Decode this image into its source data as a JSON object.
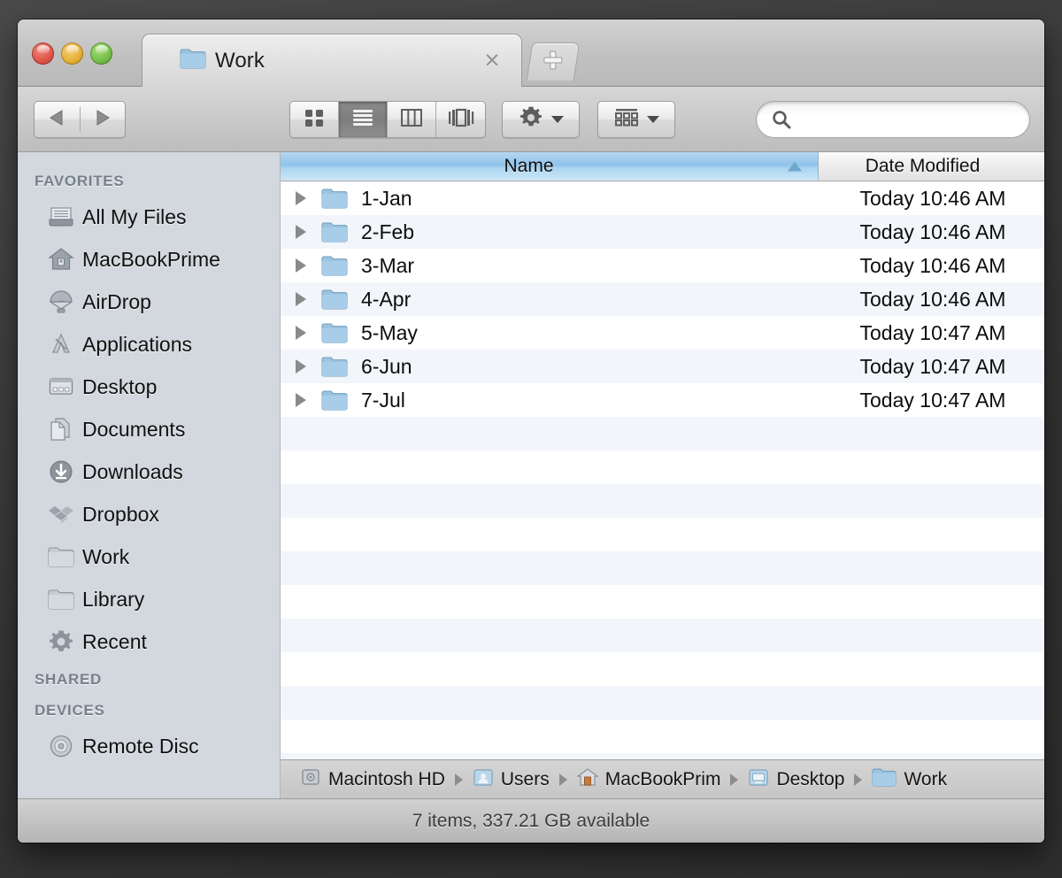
{
  "window": {
    "title": "Work",
    "traffic_lights": [
      {
        "name": "close",
        "color": "#e0574a"
      },
      {
        "name": "minimize",
        "color": "#e7b239"
      },
      {
        "name": "zoom",
        "color": "#77c04a"
      }
    ]
  },
  "tabs": {
    "active_tab_label": "Work",
    "close_glyph": "×",
    "new_tab_label": "+"
  },
  "toolbar": {
    "back_icon": "back-arrow-icon",
    "forward_icon": "forward-arrow-icon",
    "view_modes": [
      {
        "name": "icon-view",
        "selected": false
      },
      {
        "name": "list-view",
        "selected": true
      },
      {
        "name": "column-view",
        "selected": false
      },
      {
        "name": "coverflow-view",
        "selected": false
      }
    ],
    "action_menu_icon": "gear-icon",
    "arrange_menu_icon": "arrange-grid-icon",
    "search": {
      "value": "",
      "placeholder": "",
      "icon": "search-icon"
    }
  },
  "sidebar": {
    "sections": [
      {
        "header": "FAVORITES",
        "items": [
          {
            "label": "All My Files",
            "icon": "all-my-files-icon"
          },
          {
            "label": "MacBookPrime",
            "icon": "home-icon"
          },
          {
            "label": "AirDrop",
            "icon": "airdrop-parachute-icon"
          },
          {
            "label": "Applications",
            "icon": "applications-icon"
          },
          {
            "label": "Desktop",
            "icon": "desktop-icon"
          },
          {
            "label": "Documents",
            "icon": "documents-icon"
          },
          {
            "label": "Downloads",
            "icon": "downloads-icon"
          },
          {
            "label": "Dropbox",
            "icon": "dropbox-icon"
          },
          {
            "label": "Work",
            "icon": "folder-icon"
          },
          {
            "label": "Library",
            "icon": "folder-icon"
          },
          {
            "label": "Recent",
            "icon": "gear-icon"
          }
        ]
      },
      {
        "header": "SHARED",
        "items": []
      },
      {
        "header": "DEVICES",
        "items": [
          {
            "label": "Remote Disc",
            "icon": "optical-disc-icon"
          }
        ]
      }
    ]
  },
  "file_list": {
    "columns": [
      {
        "key": "name",
        "label": "Name",
        "sorted": true,
        "sort_direction": "ascending"
      },
      {
        "key": "date_modified",
        "label": "Date Modified",
        "sorted": false
      }
    ],
    "rows": [
      {
        "name": "1-Jan",
        "date_modified": "Today 10:46 AM",
        "icon": "folder-icon",
        "expandable": true
      },
      {
        "name": "2-Feb",
        "date_modified": "Today 10:46 AM",
        "icon": "folder-icon",
        "expandable": true
      },
      {
        "name": "3-Mar",
        "date_modified": "Today 10:46 AM",
        "icon": "folder-icon",
        "expandable": true
      },
      {
        "name": "4-Apr",
        "date_modified": "Today 10:46 AM",
        "icon": "folder-icon",
        "expandable": true
      },
      {
        "name": "5-May",
        "date_modified": "Today 10:47 AM",
        "icon": "folder-icon",
        "expandable": true
      },
      {
        "name": "6-Jun",
        "date_modified": "Today 10:47 AM",
        "icon": "folder-icon",
        "expandable": true
      },
      {
        "name": "7-Jul",
        "date_modified": "Today 10:47 AM",
        "icon": "folder-icon",
        "expandable": true
      }
    ]
  },
  "path_bar": {
    "segments": [
      {
        "label": "Macintosh HD",
        "icon": "hard-drive-icon"
      },
      {
        "label": "Users",
        "icon": "users-folder-icon"
      },
      {
        "label": "MacBookPrim",
        "icon": "home-folder-icon"
      },
      {
        "label": "Desktop",
        "icon": "desktop-folder-icon"
      },
      {
        "label": "Work",
        "icon": "folder-icon"
      }
    ]
  },
  "status_bar": {
    "text": "7 items, 337.21 GB available"
  }
}
